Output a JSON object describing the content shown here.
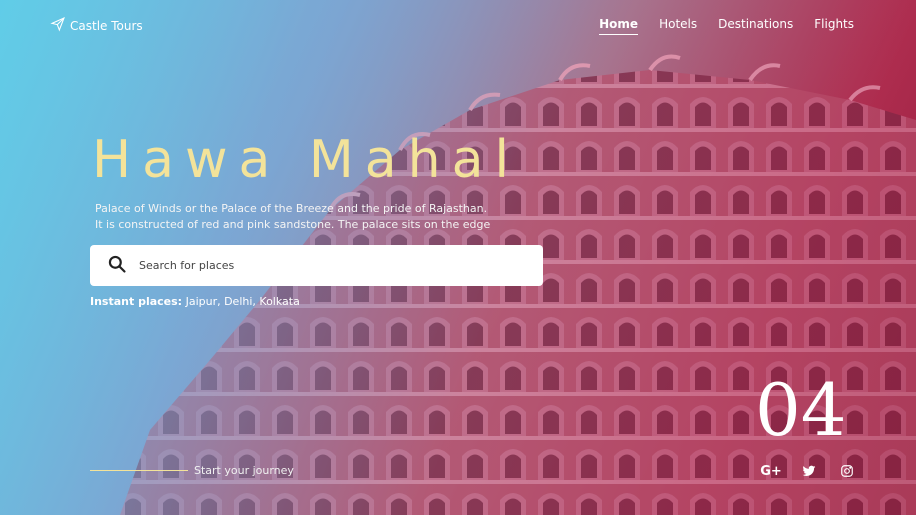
{
  "brand": {
    "name": "Castle Tours",
    "icon": "paper-plane-icon"
  },
  "nav": {
    "items": [
      {
        "label": "Home",
        "active": true
      },
      {
        "label": "Hotels",
        "active": false
      },
      {
        "label": "Destinations",
        "active": false
      },
      {
        "label": "Flights",
        "active": false
      }
    ]
  },
  "hero": {
    "title": "Hawa Mahal",
    "description_line1": "Palace of Winds or the Palace of the Breeze and the pride of Rajasthan.",
    "description_line2": "It is constructed of red and pink sandstone. The palace sits on the edge",
    "title_color": "#f3e39a"
  },
  "search": {
    "placeholder": "Search for places",
    "value": ""
  },
  "instant": {
    "label": "Instant places:",
    "places": "Jaipur, Delhi, Kolkata"
  },
  "slide": {
    "counter": "04"
  },
  "footer": {
    "journey": "Start your journey"
  },
  "social": [
    {
      "name": "google-plus-icon",
      "glyph": "G+"
    },
    {
      "name": "twitter-icon"
    },
    {
      "name": "instagram-icon"
    }
  ]
}
